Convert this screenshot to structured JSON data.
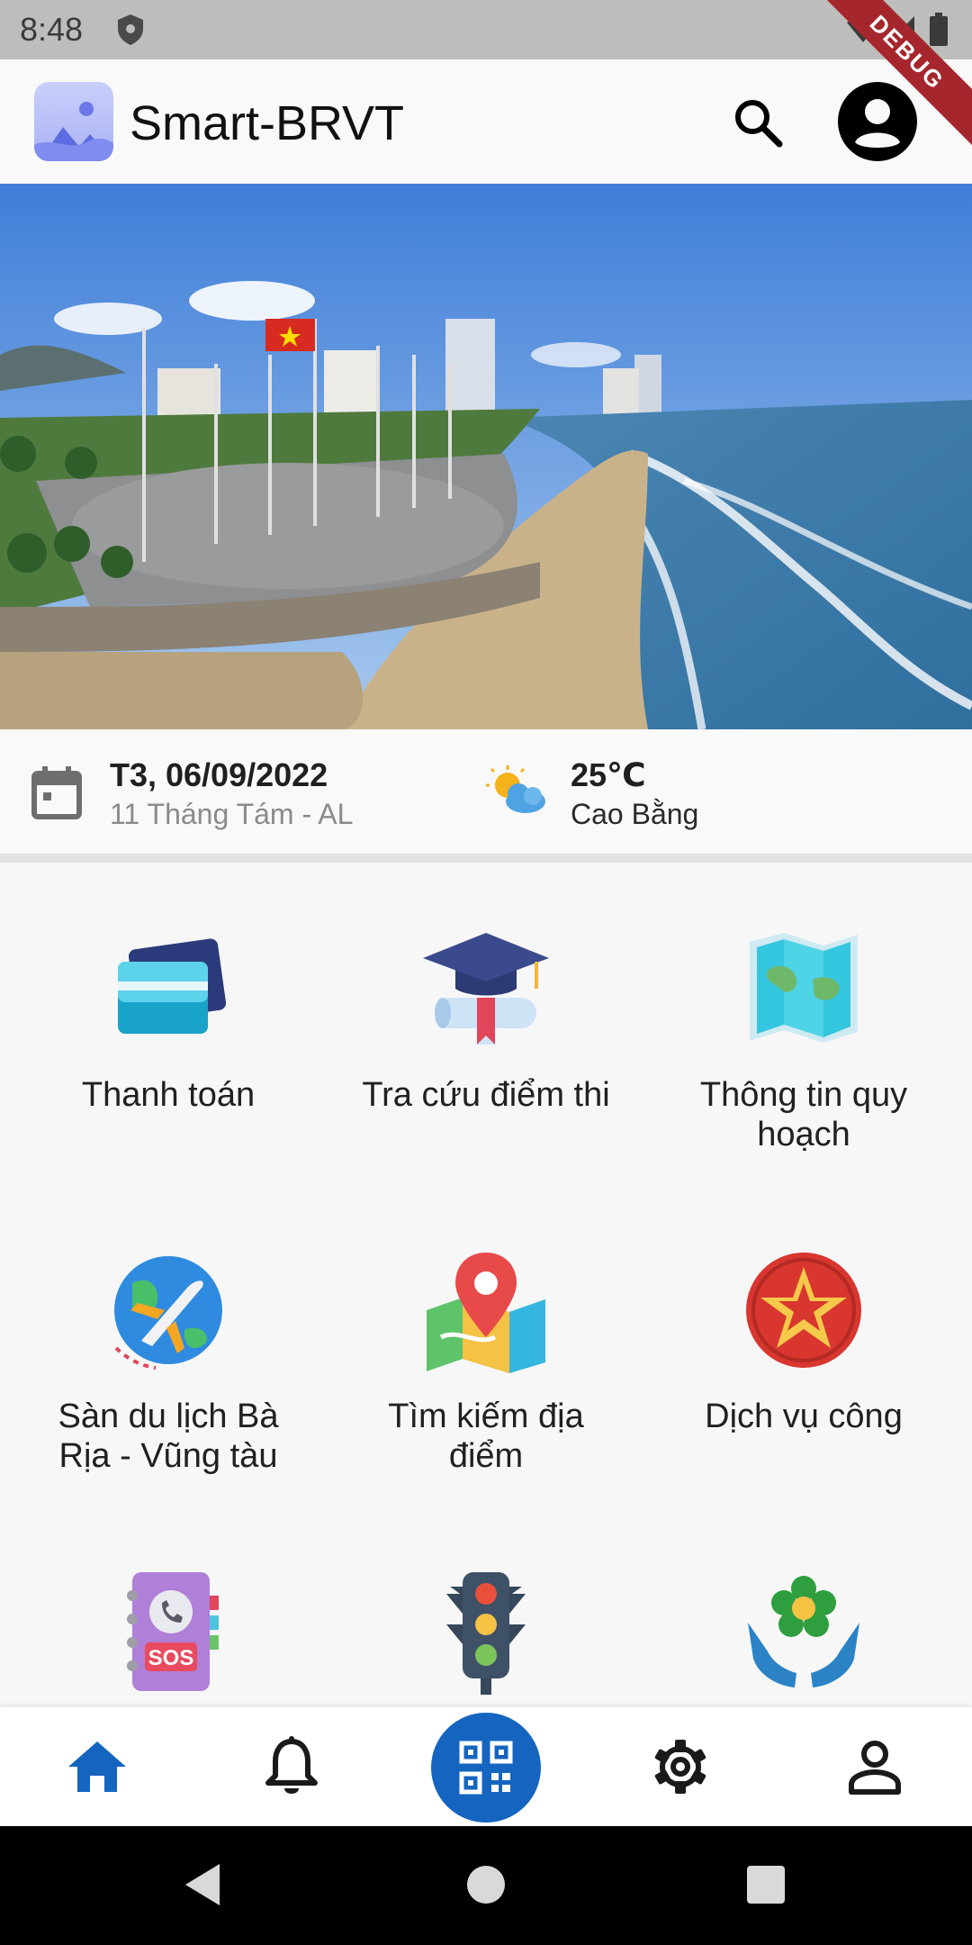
{
  "status_bar": {
    "time": "8:48",
    "debug_label": "DEBUG"
  },
  "app_bar": {
    "title": "Smart-BRVT"
  },
  "info": {
    "date": "T3, 06/09/2022",
    "lunar_date": "11 Tháng Tám - AL",
    "temperature": "25℃",
    "city": "Cao Bằng"
  },
  "services": [
    {
      "label": "Thanh toán",
      "icon": "credit-card-icon"
    },
    {
      "label": "Tra cứu điểm thi",
      "icon": "graduation-cap-icon"
    },
    {
      "label": "Thông tin quy hoạch",
      "icon": "map-icon"
    },
    {
      "label": "Sàn du lịch Bà Rịa - Vũng tàu",
      "icon": "travel-plane-icon"
    },
    {
      "label": "Tìm kiếm địa điểm",
      "icon": "map-pin-icon"
    },
    {
      "label": "Dịch vụ công",
      "icon": "public-service-star-icon"
    },
    {
      "label": "",
      "icon": "sos-phonebook-icon"
    },
    {
      "label": "",
      "icon": "traffic-light-icon"
    },
    {
      "label": "",
      "icon": "charity-hands-icon"
    }
  ],
  "bottom_nav": [
    {
      "name": "home",
      "icon": "home-icon",
      "active": true
    },
    {
      "name": "notifications",
      "icon": "bell-icon"
    },
    {
      "name": "qr",
      "icon": "qr-code-icon"
    },
    {
      "name": "settings",
      "icon": "gear-icon"
    },
    {
      "name": "profile",
      "icon": "person-icon"
    }
  ],
  "colors": {
    "primary": "#1565c0",
    "app_bar_bg": "#f9f9fa",
    "status_bar_bg": "#bdbdbd",
    "debug_ribbon": "#a5272d"
  }
}
